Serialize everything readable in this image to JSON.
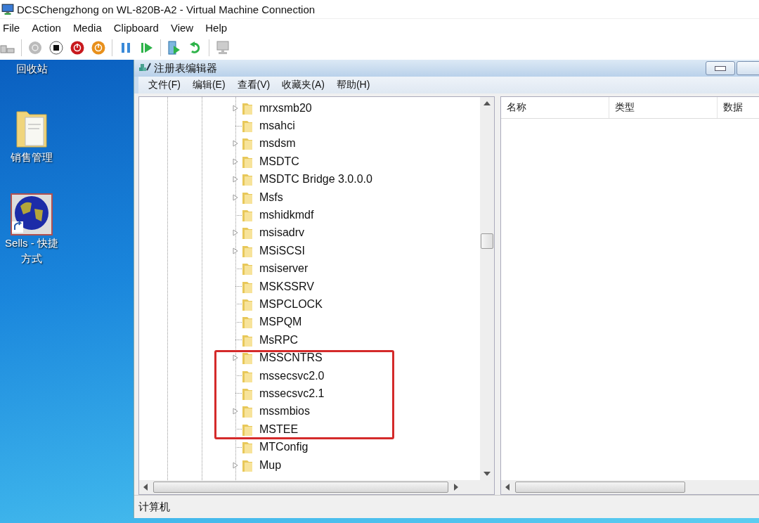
{
  "window": {
    "title": "DCSChengzhong on WL-820B-A2 - Virtual Machine Connection"
  },
  "menu": [
    "File",
    "Action",
    "Media",
    "Clipboard",
    "View",
    "Help"
  ],
  "desktop_icons": [
    {
      "kind": "label_only",
      "label": "回收站"
    },
    {
      "kind": "folder",
      "label": "销售管理"
    },
    {
      "kind": "shortcut",
      "label": "Sells - 快捷方式"
    }
  ],
  "regedit": {
    "title": "注册表编辑器",
    "menu": [
      "文件(F)",
      "编辑(E)",
      "查看(V)",
      "收藏夹(A)",
      "帮助(H)"
    ],
    "tree": [
      {
        "name": "mrxsmb20",
        "expandable": true,
        "highlighted": false
      },
      {
        "name": "msahci",
        "expandable": false,
        "highlighted": false
      },
      {
        "name": "msdsm",
        "expandable": true,
        "highlighted": false
      },
      {
        "name": "MSDTC",
        "expandable": true,
        "highlighted": false
      },
      {
        "name": "MSDTC Bridge 3.0.0.0",
        "expandable": true,
        "highlighted": false
      },
      {
        "name": "Msfs",
        "expandable": true,
        "highlighted": false
      },
      {
        "name": "mshidkmdf",
        "expandable": false,
        "highlighted": false
      },
      {
        "name": "msisadrv",
        "expandable": true,
        "highlighted": false
      },
      {
        "name": "MSiSCSI",
        "expandable": true,
        "highlighted": false
      },
      {
        "name": "msiserver",
        "expandable": false,
        "highlighted": false
      },
      {
        "name": "MSKSSRV",
        "expandable": false,
        "highlighted": false
      },
      {
        "name": "MSPCLOCK",
        "expandable": false,
        "highlighted": false
      },
      {
        "name": "MSPQM",
        "expandable": false,
        "highlighted": false
      },
      {
        "name": "MsRPC",
        "expandable": false,
        "highlighted": false
      },
      {
        "name": "MSSCNTRS",
        "expandable": true,
        "highlighted": true
      },
      {
        "name": "mssecsvc2.0",
        "expandable": false,
        "highlighted": true
      },
      {
        "name": "mssecsvc2.1",
        "expandable": false,
        "highlighted": true
      },
      {
        "name": "mssmbios",
        "expandable": true,
        "highlighted": true
      },
      {
        "name": "MSTEE",
        "expandable": false,
        "highlighted": true
      },
      {
        "name": "MTConfig",
        "expandable": false,
        "highlighted": false
      },
      {
        "name": "Mup",
        "expandable": true,
        "highlighted": false
      }
    ],
    "columns": [
      "名称",
      "类型",
      "数据"
    ],
    "status": "计算机"
  }
}
